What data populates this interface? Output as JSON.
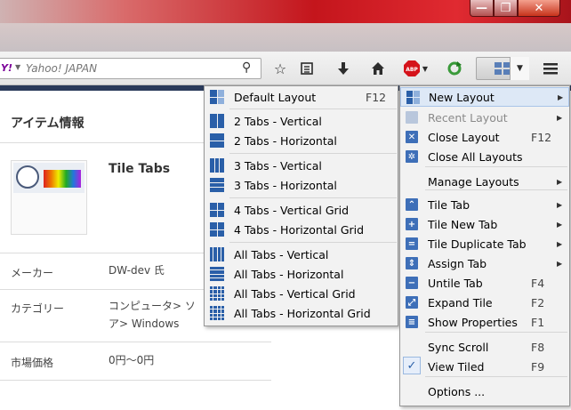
{
  "search": {
    "placeholder": "Yahoo! JAPAN"
  },
  "page": {
    "section_title": "アイテム情報",
    "product_name": "Tile Tabs",
    "rows": [
      {
        "label": "メーカー",
        "value": "DW-dev 氏"
      },
      {
        "label": "カテゴリー",
        "value": "コンピュータ> ソ\nア> Windows"
      },
      {
        "label": "市場価格",
        "value": "0円～0円"
      }
    ]
  },
  "layout_submenu": [
    {
      "label": "Default Layout",
      "shortcut": "F12",
      "icon": "default-layout-icon"
    },
    {
      "label": "2 Tabs - Vertical",
      "icon": "2-tabs-vertical-icon"
    },
    {
      "label": "2 Tabs - Horizontal",
      "icon": "2-tabs-horizontal-icon"
    },
    {
      "label": "3 Tabs - Vertical",
      "icon": "3-tabs-vertical-icon"
    },
    {
      "label": "3 Tabs - Horizontal",
      "icon": "3-tabs-horizontal-icon"
    },
    {
      "label": "4 Tabs - Vertical Grid",
      "icon": "4-tabs-vertical-grid-icon"
    },
    {
      "label": "4 Tabs - Horizontal Grid",
      "icon": "4-tabs-horizontal-grid-icon"
    },
    {
      "label": "All Tabs - Vertical",
      "icon": "all-tabs-vertical-icon"
    },
    {
      "label": "All Tabs - Horizontal",
      "icon": "all-tabs-horizontal-icon"
    },
    {
      "label": "All Tabs - Vertical Grid",
      "icon": "all-tabs-vertical-grid-icon"
    },
    {
      "label": "All Tabs - Horizontal Grid",
      "icon": "all-tabs-horizontal-grid-icon"
    }
  ],
  "tile_menu": [
    {
      "label": "New Layout",
      "submenu": true,
      "highlighted": true
    },
    {
      "label": "Recent Layout",
      "submenu": true,
      "disabled": true
    },
    {
      "label": "Close Layout",
      "shortcut": "F12"
    },
    {
      "label": "Close All Layouts"
    },
    {
      "label": "Manage Layouts",
      "submenu": true
    },
    {
      "label": "Tile Tab",
      "submenu": true
    },
    {
      "label": "Tile New Tab",
      "submenu": true
    },
    {
      "label": "Tile Duplicate Tab",
      "submenu": true
    },
    {
      "label": "Assign Tab",
      "submenu": true
    },
    {
      "label": "Untile Tab",
      "shortcut": "F4"
    },
    {
      "label": "Expand Tile",
      "shortcut": "F2"
    },
    {
      "label": "Show Properties",
      "shortcut": "F1"
    },
    {
      "label": "Sync Scroll",
      "shortcut": "F8"
    },
    {
      "label": "View Tiled",
      "shortcut": "F9",
      "checked": true
    },
    {
      "label": "Options ..."
    }
  ],
  "colors": {
    "accent": "#2a5fa8",
    "highlight": "#dde8f6",
    "titlebar": "#c4151c"
  }
}
